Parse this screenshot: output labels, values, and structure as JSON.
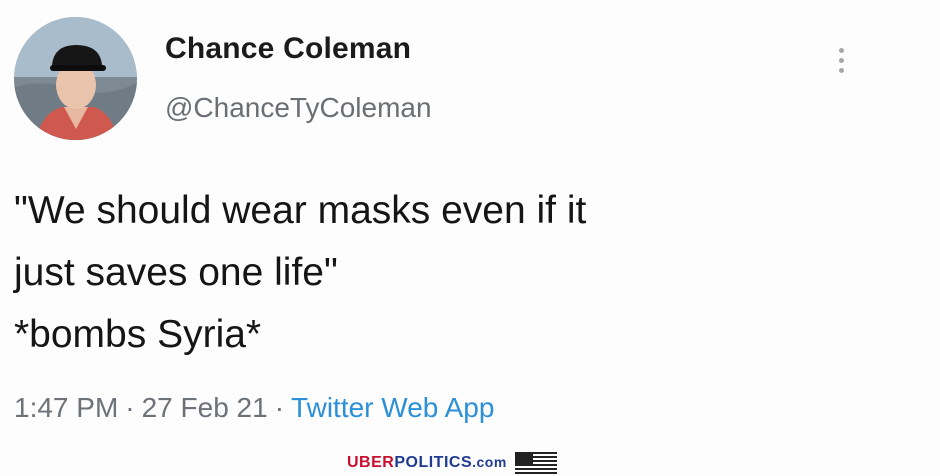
{
  "tweet": {
    "display_name": "Chance Coleman",
    "handle": "@ChanceTyColeman",
    "body_lines": [
      "\"We should wear masks even if it",
      "just saves one life\"",
      "*bombs Syria*"
    ],
    "time": "1:47 PM",
    "date": "27 Feb 21",
    "source": "Twitter Web App",
    "separator": "·"
  },
  "watermark": {
    "uber": "UBER",
    "politics": "POLITICS",
    "domain_suffix": ".com"
  },
  "icons": {
    "avatar": "profile-photo",
    "more": "vertical-ellipsis-icon",
    "flag": "us-flag-icon"
  },
  "colors": {
    "source_link": "#2b90d9",
    "muted_text": "#6d7278",
    "watermark_red": "#c8102e",
    "watermark_blue": "#1f3a93"
  }
}
